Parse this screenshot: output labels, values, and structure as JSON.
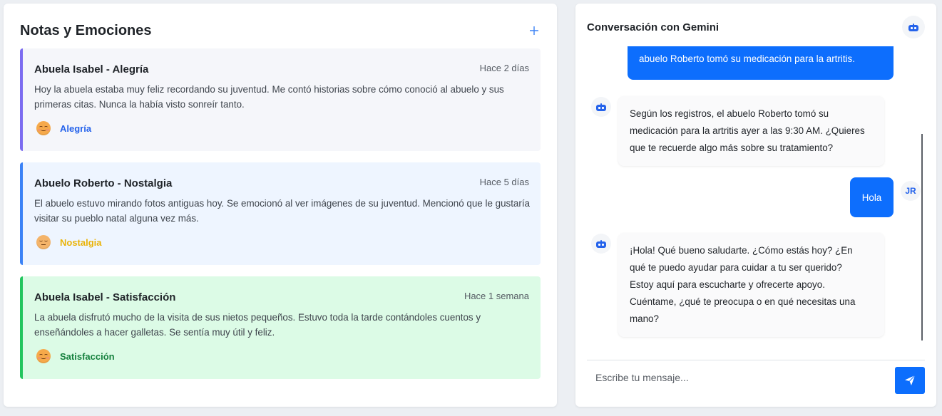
{
  "notes": {
    "title": "Notas y Emociones",
    "add_icon": "plus-icon",
    "items": [
      {
        "title": "Abuela Isabel - Alegría",
        "time": "Hace 2 días",
        "body": "Hoy la abuela estaba muy feliz recordando su juventud. Me contó historias sobre cómo conoció al abuelo y sus primeras citas. Nunca la había visto sonreír tanto.",
        "emotion": "Alegría",
        "emoji": "smiling-face-icon",
        "accent_color": "#7c6cf0",
        "label_color": "#2563eb",
        "background": "#f5f6fa"
      },
      {
        "title": "Abuelo Roberto - Nostalgia",
        "time": "Hace 5 días",
        "body": "El abuelo estuvo mirando fotos antiguas hoy. Se emocionó al ver imágenes de su juventud. Mencionó que le gustaría visitar su pueblo natal alguna vez más.",
        "emotion": "Nostalgia",
        "emoji": "pensive-face-icon",
        "accent_color": "#3b82f6",
        "label_color": "#eab308",
        "background": "#eef5ff"
      },
      {
        "title": "Abuela Isabel - Satisfacción",
        "time": "Hace 1 semana",
        "body": "La abuela disfrutó mucho de la visita de sus nietos pequeños. Estuvo toda la tarde contándoles cuentos y enseñándoles a hacer galletas. Se sentía muy útil y feliz.",
        "emotion": "Satisfacción",
        "emoji": "smiling-face-icon",
        "accent_color": "#22c55e",
        "label_color": "#15803d",
        "background": "#dcfbe6"
      }
    ]
  },
  "chat": {
    "title": "Conversación con Gemini",
    "header_icon": "robot-icon",
    "messages": [
      {
        "role": "user",
        "text": "abuelo Roberto tomó su medicación para la artritis."
      },
      {
        "role": "bot",
        "lines": [
          "Según los registros, el abuelo Roberto tomó su",
          "medicación para la artritis ayer a las 9:30 AM. ¿Quieres",
          "que te recuerde algo más sobre su tratamiento?"
        ]
      },
      {
        "role": "user",
        "text": "Hola",
        "avatar": "JR"
      },
      {
        "role": "bot",
        "lines": [
          "¡Hola! Qué bueno saludarte. ¿Cómo estás hoy? ¿En",
          "qué te puedo ayudar para cuidar a tu ser querido?",
          "Estoy aquí para escucharte y ofrecerte apoyo.",
          "Cuéntame, ¿qué te preocupa o en qué necesitas una",
          "mano?"
        ]
      }
    ],
    "input_placeholder": "Escribe tu mensaje...",
    "send_icon": "send-icon",
    "accent": "#0d6efd"
  }
}
